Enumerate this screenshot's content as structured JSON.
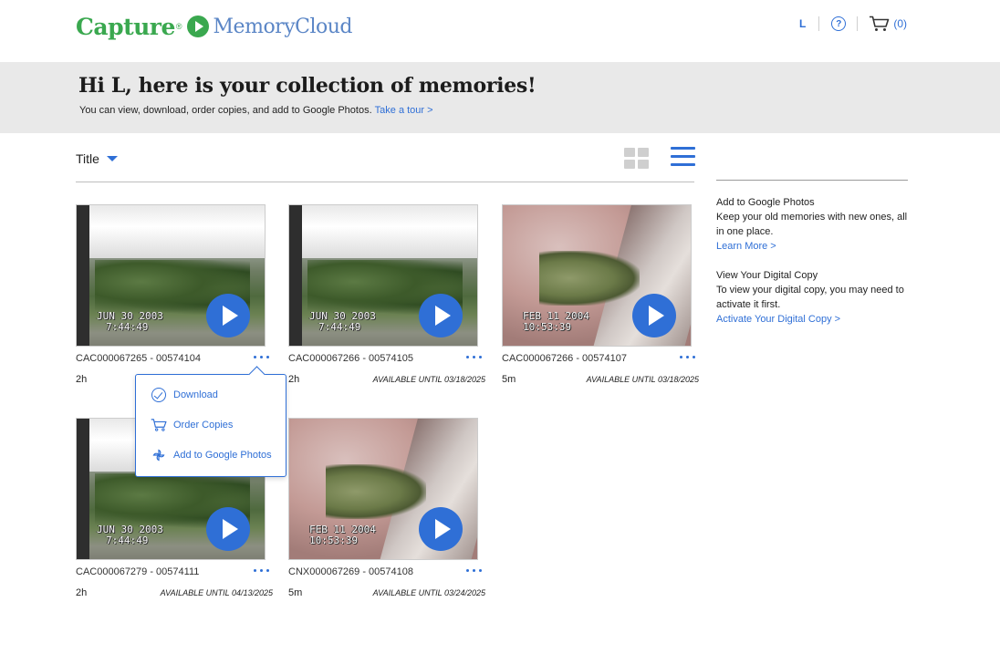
{
  "brand": {
    "name_primary": "Capture",
    "name_secondary": "MemoryCloud",
    "reg_mark": "®",
    "primary_color": "#3aa84f",
    "secondary_color": "#5b86c6"
  },
  "header": {
    "user_initial": "L",
    "help_icon": "help-circle-icon",
    "help_glyph": "?",
    "cart_icon": "cart-icon",
    "cart_count": "(0)"
  },
  "banner": {
    "heading": "Hi L, here is your collection of memories!",
    "subtext": "You can view, download, order copies, and add to Google Photos.",
    "tour_link": "Take a tour >"
  },
  "toolbar": {
    "sort_label": "Title",
    "view_grid_icon": "grid-view-icon",
    "view_list_icon": "list-view-icon",
    "active_view": "list"
  },
  "videos": [
    {
      "title": "CAC000067265 - 00574104",
      "duration": "2h",
      "availability": "",
      "stamp_line1": "JUN 30 2003",
      "stamp_line2": "7:44:49"
    },
    {
      "title": "CAC000067266 - 00574105",
      "duration": "2h",
      "availability": "AVAILABLE UNTIL 03/18/2025",
      "stamp_line1": "JUN 30 2003",
      "stamp_line2": "7:44:49"
    },
    {
      "title": "CAC000067266 - 00574107",
      "duration": "5m",
      "availability": "AVAILABLE UNTIL 03/18/2025",
      "stamp_line1": "FEB 11 2004",
      "stamp_line2": "10:53:39"
    },
    {
      "title": "CAC000067279 - 00574111",
      "duration": "2h",
      "availability": "AVAILABLE UNTIL 04/13/2025",
      "stamp_line1": "JUN 30 2003",
      "stamp_line2": "7:44:49"
    },
    {
      "title": "CNX000067269 - 00574108",
      "duration": "5m",
      "availability": "AVAILABLE UNTIL 03/24/2025",
      "stamp_line1": "FEB 11 2004",
      "stamp_line2": "10:53:39"
    }
  ],
  "context_menu": {
    "items": [
      {
        "label": "Download",
        "icon": "check-circle-icon"
      },
      {
        "label": "Order Copies",
        "icon": "cart-icon"
      },
      {
        "label": "Add to Google Photos",
        "icon": "pinwheel-icon"
      }
    ]
  },
  "sidebar": {
    "google_title": "Add to Google Photos",
    "google_text": "Keep your old memories with new ones, all in one place.",
    "google_link": "Learn More >",
    "digital_title": "View Your Digital Copy",
    "digital_text": "To view your digital copy, you may need to activate it first.",
    "digital_link": "Activate Your Digital Copy >"
  }
}
